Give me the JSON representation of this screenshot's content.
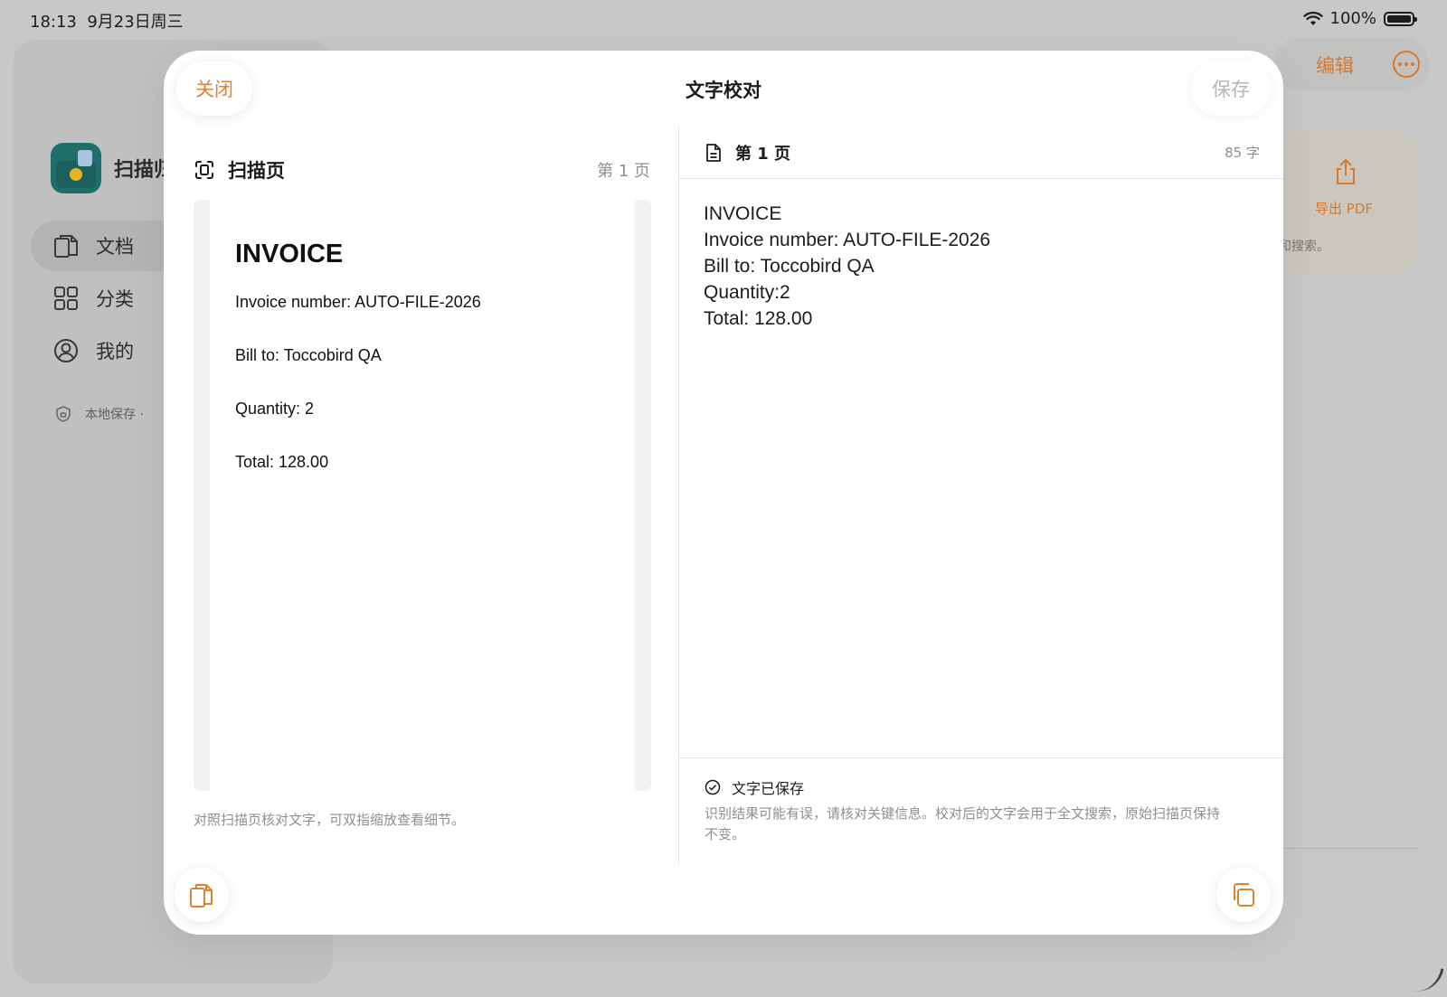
{
  "status": {
    "time": "18:13",
    "date": "9月23日周三",
    "battery": "100%",
    "icons": [
      "wifi-icon",
      "battery-icon"
    ]
  },
  "background": {
    "app_name": "扫描归",
    "nav": [
      {
        "label": "文档",
        "icon": "documents-icon",
        "active": true
      },
      {
        "label": "分类",
        "icon": "grid-icon",
        "active": false
      },
      {
        "label": "我的",
        "icon": "person-icon",
        "active": false
      }
    ],
    "local_note": "本地保存 ·",
    "edit_label": "编辑",
    "export_label": "导出 PDF",
    "search_note": "和搜索。"
  },
  "sheet": {
    "close_label": "关闭",
    "title": "文字校对",
    "save_label": "保存",
    "left": {
      "header_title": "扫描页",
      "page_label": "第 1 页",
      "scan": {
        "title": "INVOICE",
        "lines": [
          "Invoice number: AUTO-FILE-2026",
          "Bill to: Toccobird QA",
          "Quantity: 2",
          "Total: 128.00"
        ]
      },
      "hint": "对照扫描页核对文字，可双指缩放查看细节。"
    },
    "right": {
      "header_title": "第 1 页",
      "char_count": "85 字",
      "text": "INVOICE\nInvoice number: AUTO-FILE-2026\nBill to: Toccobird QA\nQuantity:2\nTotal: 128.00",
      "saved_label": "文字已保存",
      "description": "识别结果可能有误，请核对关键信息。校对后的文字会用于全文搜索，原始扫描页保持不变。"
    }
  },
  "colors": {
    "accent": "#e0822d",
    "muted": "#8e8e93",
    "disabled": "#b6b6b6"
  }
}
